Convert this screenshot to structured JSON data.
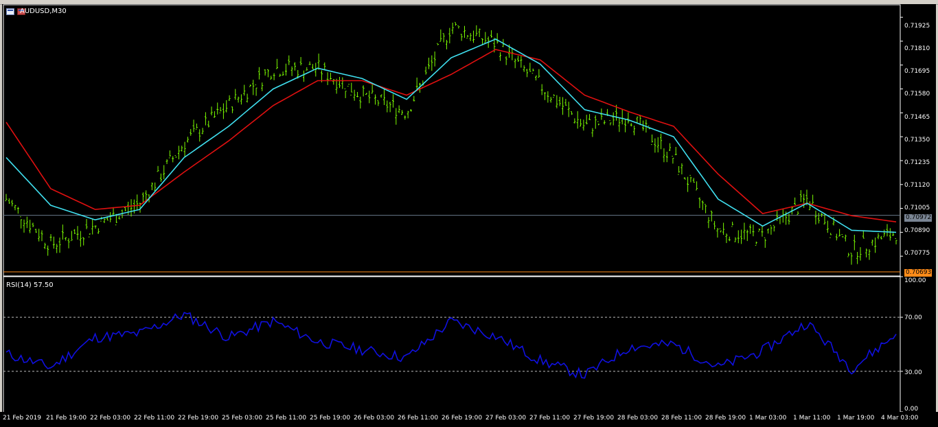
{
  "window": {
    "title": "AUDUSD,M30"
  },
  "indicator": {
    "label": "RSI(14) 57.50"
  },
  "price_axis": {
    "ticks": [
      "0.71925",
      "0.71810",
      "0.71695",
      "0.71580",
      "0.71465",
      "0.71350",
      "0.71235",
      "0.71120",
      "0.71005",
      "0.70890",
      "0.70775"
    ],
    "current_price": "0.70972",
    "low_line_price": "0.70693"
  },
  "rsi_axis": {
    "ticks": [
      "100.00",
      "70.00",
      "30.00",
      "0.00"
    ]
  },
  "time_axis": {
    "ticks": [
      "21 Feb 2019",
      "21 Feb 19:00",
      "22 Feb 03:00",
      "22 Feb 11:00",
      "22 Feb 19:00",
      "25 Feb 03:00",
      "25 Feb 11:00",
      "25 Feb 19:00",
      "26 Feb 03:00",
      "26 Feb 11:00",
      "26 Feb 19:00",
      "27 Feb 03:00",
      "27 Feb 11:00",
      "27 Feb 19:00",
      "28 Feb 03:00",
      "28 Feb 11:00",
      "28 Feb 19:00",
      "1 Mar 03:00",
      "1 Mar 11:00",
      "1 Mar 19:00",
      "4 Mar 03:00"
    ]
  },
  "colors": {
    "background": "#000000",
    "candles": "#7CFC00",
    "ma_fast": "#40E0F0",
    "ma_slow": "#E01010",
    "rsi_line": "#1010E0",
    "current_price_line": "#6a7a8a",
    "low_line": "#ff8c1a"
  },
  "chart_data": [
    {
      "type": "line",
      "title": "AUDUSD,M30",
      "x": [
        "21 Feb 2019",
        "21 Feb 19:00",
        "22 Feb 03:00",
        "22 Feb 11:00",
        "22 Feb 19:00",
        "25 Feb 03:00",
        "25 Feb 11:00",
        "25 Feb 19:00",
        "26 Feb 03:00",
        "26 Feb 11:00",
        "26 Feb 19:00",
        "27 Feb 03:00",
        "27 Feb 11:00",
        "27 Feb 19:00",
        "28 Feb 03:00",
        "28 Feb 11:00",
        "28 Feb 19:00",
        "1 Mar 03:00",
        "1 Mar 11:00",
        "1 Mar 19:00",
        "4 Mar 03:00"
      ],
      "series": [
        {
          "values": [
            0.7105,
            0.7083,
            0.7092,
            0.7103,
            0.7132,
            0.715,
            0.7168,
            0.7168,
            0.7155,
            0.7147,
            0.7188,
            0.718,
            0.716,
            0.714,
            0.7145,
            0.7125,
            0.709,
            0.7087,
            0.7105,
            0.708,
            0.7089
          ]
        },
        {
          "values": [
            0.7125,
            0.7102,
            0.7095,
            0.71,
            0.7125,
            0.714,
            0.7158,
            0.7168,
            0.7163,
            0.7153,
            0.7173,
            0.7182,
            0.717,
            0.7148,
            0.7143,
            0.7135,
            0.7105,
            0.7092,
            0.7103,
            0.709,
            0.7089
          ]
        },
        {
          "values": [
            0.7142,
            0.711,
            0.71,
            0.7102,
            0.7118,
            0.7133,
            0.715,
            0.7162,
            0.7162,
            0.7155,
            0.7165,
            0.7177,
            0.7172,
            0.7155,
            0.7147,
            0.714,
            0.7117,
            0.7098,
            0.7103,
            0.7097,
            0.7094
          ]
        }
      ],
      "ylim": [
        0.70693,
        0.71985
      ]
    },
    {
      "type": "line",
      "title": "RSI(14) 57.50",
      "x": [
        "21 Feb 2019",
        "21 Feb 19:00",
        "22 Feb 03:00",
        "22 Feb 11:00",
        "22 Feb 19:00",
        "25 Feb 03:00",
        "25 Feb 11:00",
        "25 Feb 19:00",
        "26 Feb 03:00",
        "26 Feb 11:00",
        "26 Feb 19:00",
        "27 Feb 03:00",
        "27 Feb 11:00",
        "27 Feb 19:00",
        "28 Feb 03:00",
        "28 Feb 11:00",
        "28 Feb 19:00",
        "1 Mar 03:00",
        "1 Mar 11:00",
        "1 Mar 19:00",
        "4 Mar 03:00"
      ],
      "series": [
        {
          "values": [
            43,
            33,
            55,
            58,
            72,
            55,
            67,
            52,
            46,
            40,
            67,
            56,
            38,
            27,
            48,
            50,
            33,
            45,
            66,
            32,
            57.5
          ]
        }
      ],
      "ylim": [
        0,
        100
      ],
      "levels": [
        70,
        30
      ]
    }
  ]
}
